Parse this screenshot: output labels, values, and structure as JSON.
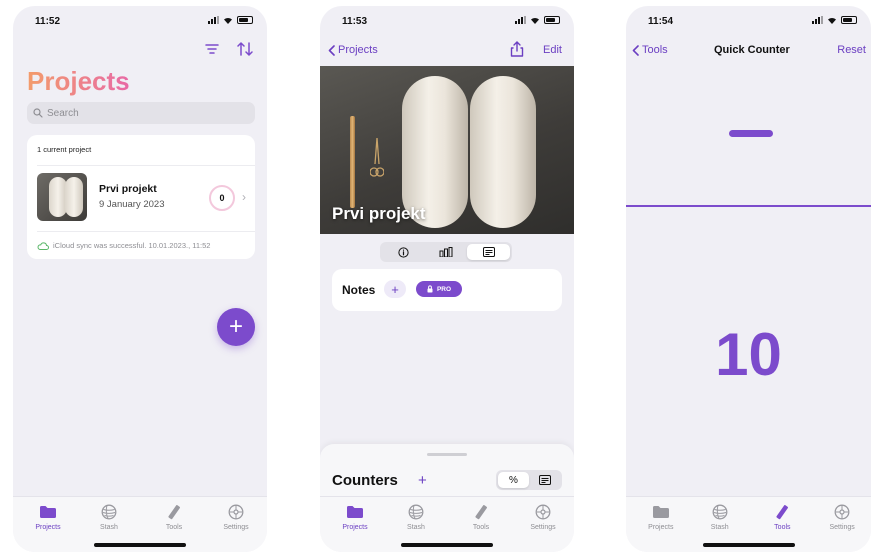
{
  "screens": [
    {
      "time": "11:52",
      "title": "Projects",
      "search_placeholder": "Search",
      "current_label": "1 current project",
      "project": {
        "name": "Prvi projekt",
        "date": "9 January 2023",
        "count": "0"
      },
      "sync_text": "iCloud sync was successful. 10.01.2023., 11:52",
      "fab_label": "+"
    },
    {
      "time": "11:53",
      "back_label": "Projects",
      "edit_label": "Edit",
      "hero_title": "Prvi projekt",
      "notes_label": "Notes",
      "plus_label": "+",
      "pro_label": "PRO",
      "counters_label": "Counters",
      "percent_label": "%"
    },
    {
      "time": "11:54",
      "back_label": "Tools",
      "title": "Quick Counter",
      "reset_label": "Reset",
      "count": "10"
    }
  ],
  "tabs": [
    "Projects",
    "Stash",
    "Tools",
    "Settings"
  ],
  "active_tabs": [
    0,
    0,
    2
  ],
  "colors": {
    "accent": "#7c4bcc",
    "title_grad_start": "#f39c6b",
    "title_grad_end": "#e86aa6",
    "background": "#f0eff5"
  },
  "icons": [
    "folder-icon",
    "yarn-ball-icon",
    "ruler-icon",
    "gear-icon",
    "filter-icon",
    "sort-icon",
    "share-icon",
    "info-icon",
    "bar-chart-icon",
    "notes-icon",
    "lock-icon",
    "cloud-icon"
  ]
}
